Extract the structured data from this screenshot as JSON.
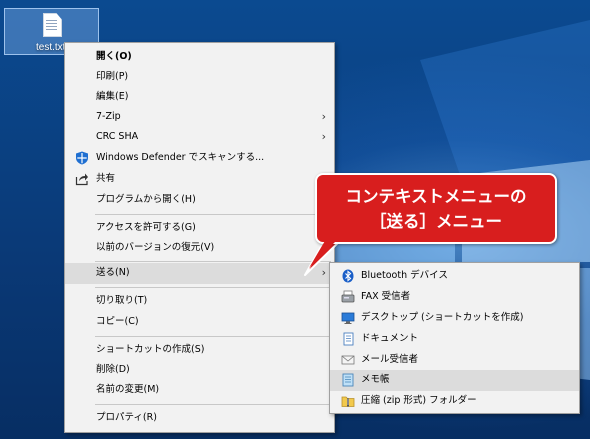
{
  "desktop": {
    "icon": {
      "name": "test.txt"
    }
  },
  "context_menu": {
    "items": [
      {
        "label": "開く(O)",
        "bold": true
      },
      {
        "label": "印刷(P)"
      },
      {
        "label": "編集(E)"
      },
      {
        "label": "7-Zip",
        "submenu": true
      },
      {
        "label": "CRC SHA",
        "submenu": true
      },
      {
        "label": "Windows Defender でスキャンする...",
        "icon": "defender-shield-icon"
      },
      {
        "label": "共有",
        "icon": "share-icon"
      },
      {
        "label": "プログラムから開く(H)"
      },
      {
        "label": "アクセスを許可する(G)"
      },
      {
        "label": "以前のバージョンの復元(V)"
      },
      {
        "label": "送る(N)",
        "submenu": true,
        "highlighted": true
      },
      {
        "label": "切り取り(T)"
      },
      {
        "label": "コピー(C)"
      },
      {
        "label": "ショートカットの作成(S)"
      },
      {
        "label": "削除(D)"
      },
      {
        "label": "名前の変更(M)"
      },
      {
        "label": "プロパティ(R)"
      }
    ],
    "arrow_glyph": "›"
  },
  "send_to_menu": {
    "items": [
      {
        "label": "Bluetooth デバイス",
        "icon": "bluetooth-icon"
      },
      {
        "label": "FAX 受信者",
        "icon": "fax-icon"
      },
      {
        "label": "デスクトップ (ショートカットを作成)",
        "icon": "desktop-icon"
      },
      {
        "label": "ドキュメント",
        "icon": "documents-icon"
      },
      {
        "label": "メール受信者",
        "icon": "mail-icon"
      },
      {
        "label": "メモ帳",
        "icon": "notepad-icon",
        "highlighted": true
      },
      {
        "label": "圧縮 (zip 形式) フォルダー",
        "icon": "zip-folder-icon"
      }
    ]
  },
  "callout": {
    "line1": "コンテキストメニューの",
    "line2": "［送る］メニュー",
    "color": "#d81e1e"
  },
  "colors": {
    "menu_bg": "#f2f2f2",
    "highlight": "#dcdcdc",
    "desktop_blue": "#0a3d7a"
  }
}
